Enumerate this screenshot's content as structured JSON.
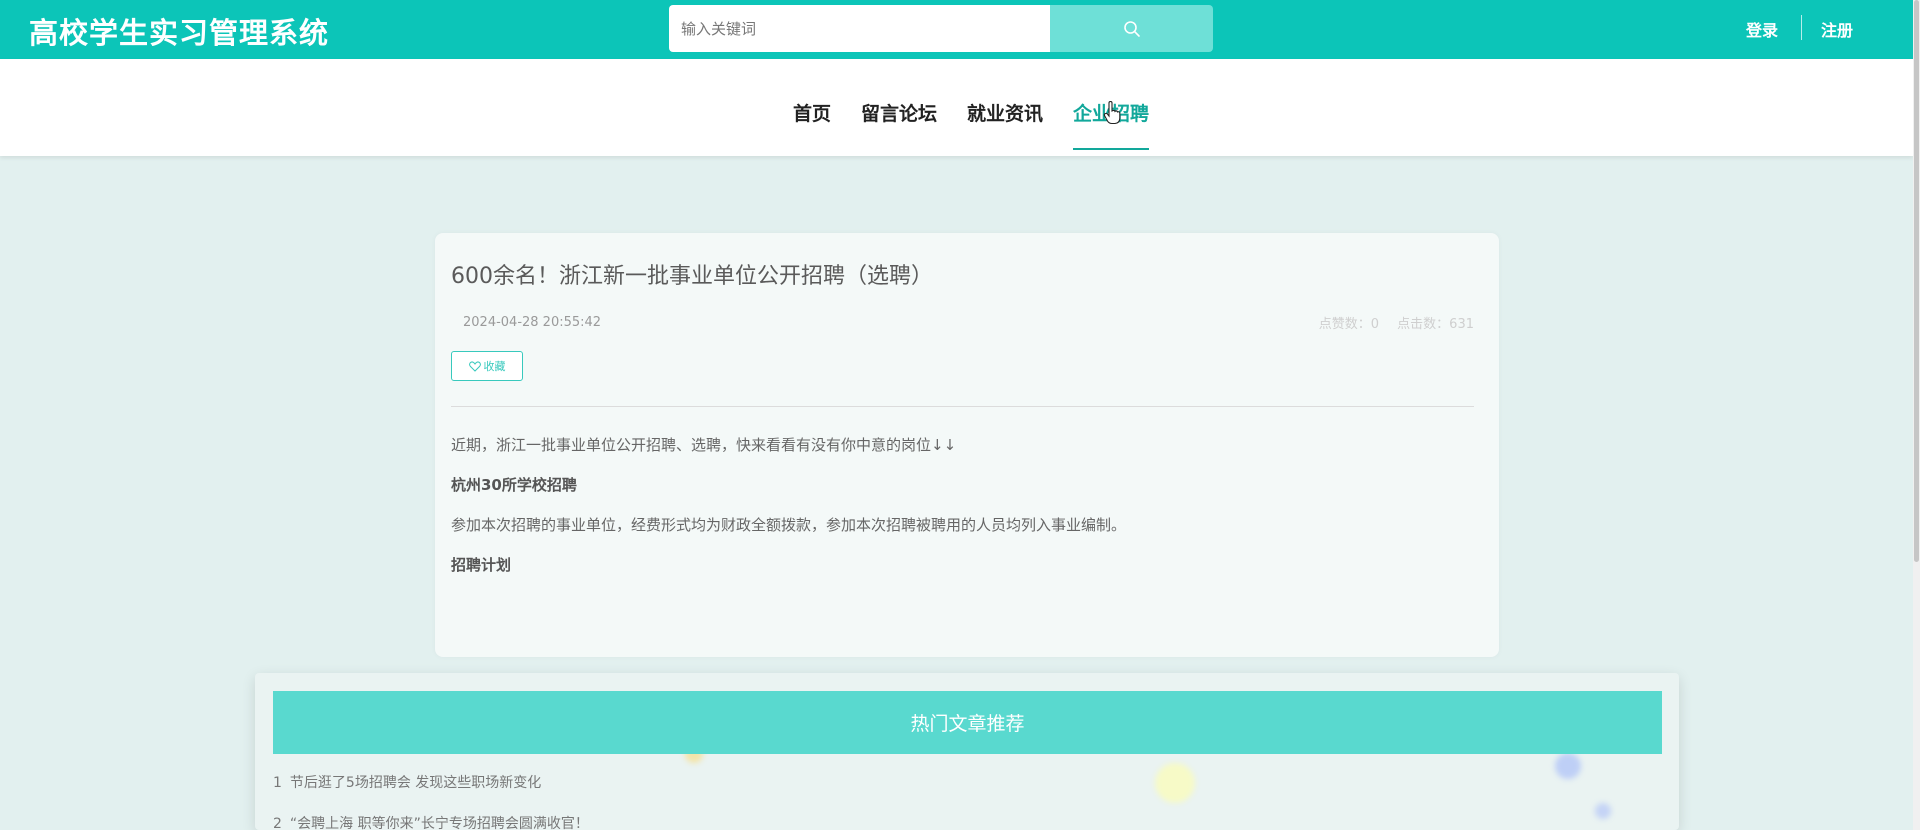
{
  "header": {
    "brand": "高校学生实习管理系统",
    "search_placeholder": "输入关键词",
    "login_label": "登录",
    "register_label": "注册",
    "accent_color": "#0cc5b8"
  },
  "nav": {
    "items": [
      {
        "label": "首页"
      },
      {
        "label": "留言论坛"
      },
      {
        "label": "就业资讯"
      },
      {
        "label": "企业招聘"
      }
    ],
    "active": "企业招聘"
  },
  "article": {
    "title": "600余名！浙江新一批事业单位公开招聘（选聘）",
    "date": "2024-04-28 20:55:42",
    "likes": "点赞数：0",
    "clicks": "点击数：631",
    "favorite_label": "收藏",
    "paragraphs": {
      "intro": "近期，浙江一批事业单位公开招聘、选聘，快来看看有没有你中意的岗位↓↓",
      "heading1": "杭州30所学校招聘",
      "body1": "参加本次招聘的事业单位，经费形式均为财政全额拨款，参加本次招聘被聘用的人员均列入事业编制。",
      "heading2": "招聘计划"
    }
  },
  "hot": {
    "title": "热门文章推荐",
    "items": [
      {
        "index": "1",
        "text": "节后逛了5场招聘会 发现这些职场新变化"
      },
      {
        "index": "2",
        "text": "“会聘上海 职等你来”长宁专场招聘会圆满收官！"
      }
    ]
  }
}
